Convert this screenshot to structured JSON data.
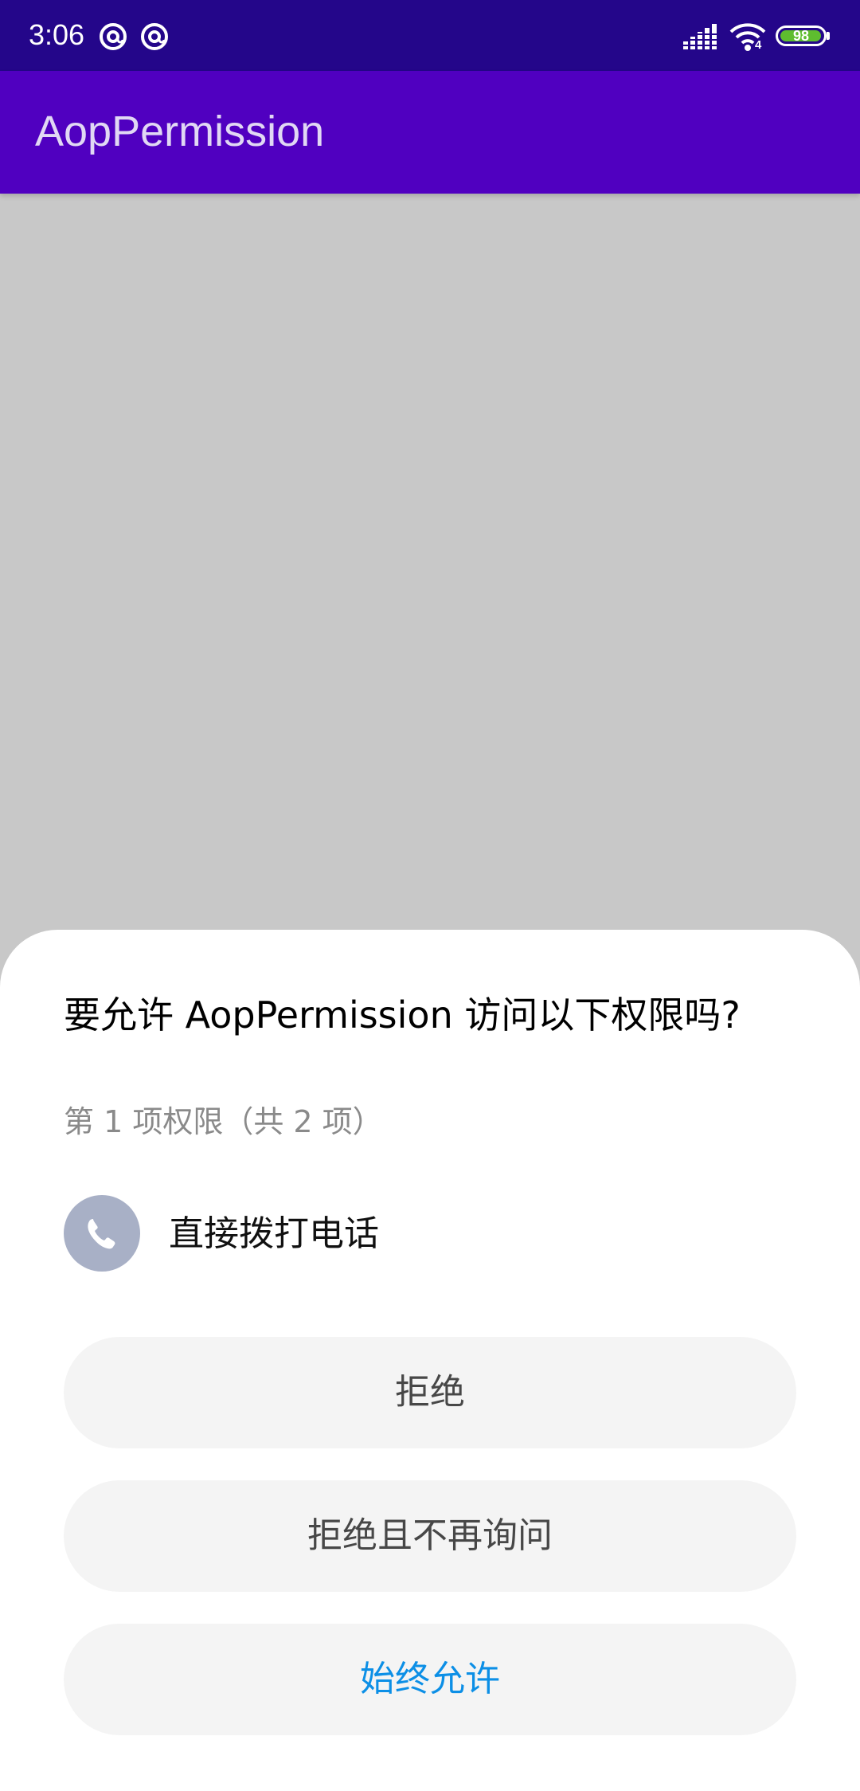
{
  "status_bar": {
    "time": "3:06",
    "battery_level": "98",
    "battery_fraction": 0.98,
    "wifi_generation": "4",
    "notification_icons": [
      "at-sign-icon",
      "at-sign-icon"
    ],
    "colors": {
      "background": "#24068a",
      "battery_fill": "#5ebd2f"
    }
  },
  "app_bar": {
    "title": "AopPermission",
    "colors": {
      "background": "#5000c0",
      "title": "#e1d8f4"
    }
  },
  "dialog": {
    "title": "要允许 AopPermission 访问以下权限吗?",
    "subtitle": "第 1 项权限（共 2 项）",
    "permission": {
      "icon": "phone-icon",
      "label": "直接拨打电话"
    },
    "buttons": {
      "deny": "拒绝",
      "deny_dont_ask": "拒绝且不再询问",
      "always_allow": "始终允许"
    },
    "colors": {
      "allow_text": "#0c8fe6",
      "button_bg": "#f4f4f4",
      "icon_bg": "#a8b0c6"
    }
  }
}
